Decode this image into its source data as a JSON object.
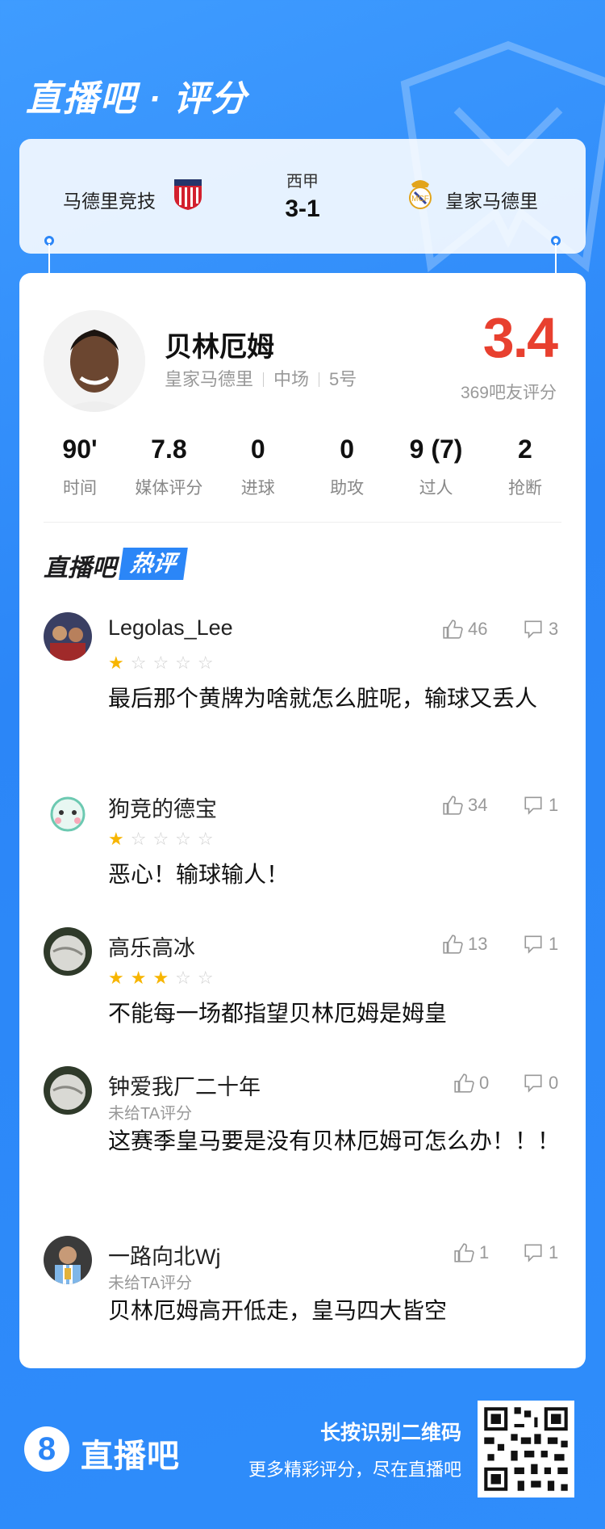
{
  "app": {
    "title": "直播吧 · 评分",
    "brand": "直播吧"
  },
  "match": {
    "league": "西甲",
    "score": "3-1",
    "home_team": "马德里竞技",
    "away_team": "皇家马德里"
  },
  "player": {
    "name": "贝林厄姆",
    "team": "皇家马德里",
    "position": "中场",
    "number": "5号",
    "rating": "3.4",
    "rating_count_label": "369吧友评分",
    "stats": [
      {
        "value": "90'",
        "label": "时间"
      },
      {
        "value": "7.8",
        "label": "媒体评分"
      },
      {
        "value": "0",
        "label": "进球"
      },
      {
        "value": "0",
        "label": "助攻"
      },
      {
        "value": "9 (7)",
        "label": "过人"
      },
      {
        "value": "2",
        "label": "抢断"
      }
    ]
  },
  "hot_comments": {
    "title_brand": "直播吧",
    "title_tag": "热评",
    "items": [
      {
        "user": "Legolas_Lee",
        "stars": 1,
        "likes": "46",
        "replies": "3",
        "text": "最后那个黄牌为啥就怎么脏呢，输球又丢人"
      },
      {
        "user": "狗竞的德宝",
        "stars": 1,
        "likes": "34",
        "replies": "1",
        "text": "恶心！输球输人！"
      },
      {
        "user": "高乐高冰",
        "stars": 3,
        "likes": "13",
        "replies": "1",
        "text": "不能每一场都指望贝林厄姆是姆皇"
      },
      {
        "user": "钟爱我厂二十年",
        "unrated": "未给TA评分",
        "likes": "0",
        "replies": "0",
        "text": "这赛季皇马要是没有贝林厄姆可怎么办！！！"
      },
      {
        "user": "一路向北Wj",
        "unrated": "未给TA评分",
        "likes": "1",
        "replies": "1",
        "text": "贝林厄姆高开低走，皇马四大皆空"
      }
    ]
  },
  "footer": {
    "qr_title": "长按识别二维码",
    "qr_subtitle": "更多精彩评分，尽在直播吧"
  },
  "colors": {
    "brand_blue": "#2b86f7",
    "rating_red": "#e8402f",
    "star_gold": "#f7b500"
  }
}
